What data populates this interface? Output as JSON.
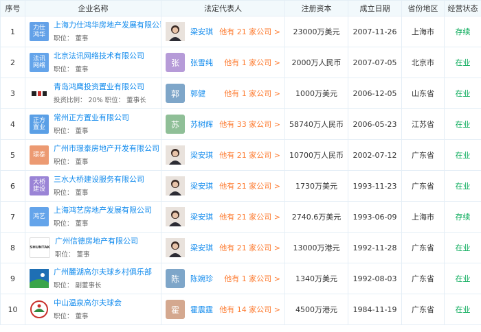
{
  "headers": {
    "index": "序号",
    "company": "企业名称",
    "rep": "法定代表人",
    "capital": "注册资本",
    "date": "成立日期",
    "region": "省份地区",
    "status": "经营状态"
  },
  "rows": [
    {
      "idx": "1",
      "logo": "力仕\n鸿华",
      "logo_color": "#63a1e8",
      "name": "上海力仕鸿华房地产发展有限公司",
      "meta": "职位：  董事",
      "rep_avatar": "",
      "rep_avatar_color": "photo",
      "rep_name": "梁安琪",
      "rep_more": "他有 21 家公司 >",
      "capital": "23000万美元",
      "date": "2007-11-26",
      "region": "上海市",
      "status": "存续"
    },
    {
      "idx": "2",
      "logo": "法讯\n网络",
      "logo_color": "#64a4ea",
      "name": "北京法讯网络技术有限公司",
      "meta": "职位：  董事",
      "rep_avatar": "张",
      "rep_avatar_color": "#b69bd8",
      "rep_name": "张雪纯",
      "rep_more": "他有 1 家公司 >",
      "capital": "2000万人民币",
      "date": "2007-07-05",
      "region": "北京市",
      "status": "在业"
    },
    {
      "idx": "3",
      "logo": "",
      "logo_color": "#ffffff",
      "name": "青岛鸿鹰投资置业有限公司",
      "meta": "投资比例：  20%      职位：  董事长",
      "rep_avatar": "郭",
      "rep_avatar_color": "#7ea6c9",
      "rep_name": "郭健",
      "rep_more": "他有 1 家公司 >",
      "capital": "1000万美元",
      "date": "2006-12-05",
      "region": "山东省",
      "status": "在业"
    },
    {
      "idx": "4",
      "logo": "正方\n置业",
      "logo_color": "#5a9fe6",
      "name": "常州正方置业有限公司",
      "meta": "职位：  董事",
      "rep_avatar": "苏",
      "rep_avatar_color": "#8fbf97",
      "rep_name": "苏树辉",
      "rep_more": "他有 33 家公司 >",
      "capital": "58740万人民币",
      "date": "2006-05-23",
      "region": "江苏省",
      "status": "在业"
    },
    {
      "idx": "5",
      "logo": "璟泰",
      "logo_color": "#ec9a72",
      "name": "广州市璟泰房地产开发有限公司",
      "meta": "职位：  董事",
      "rep_avatar": "",
      "rep_avatar_color": "photo",
      "rep_name": "梁安琪",
      "rep_more": "他有 21 家公司 >",
      "capital": "10700万人民币",
      "date": "2002-07-12",
      "region": "广东省",
      "status": "在业"
    },
    {
      "idx": "6",
      "logo": "大桥\n建设",
      "logo_color": "#9a84d6",
      "name": "三水大桥建设服务有限公司",
      "meta": "职位：  董事",
      "rep_avatar": "",
      "rep_avatar_color": "photo",
      "rep_name": "梁安琪",
      "rep_more": "他有 21 家公司 >",
      "capital": "1730万美元",
      "date": "1993-11-23",
      "region": "广东省",
      "status": "在业"
    },
    {
      "idx": "7",
      "logo": "鸿艺",
      "logo_color": "#64a4ea",
      "name": "上海鸿艺房地产发展有限公司",
      "meta": "职位：  董事",
      "rep_avatar": "",
      "rep_avatar_color": "photo",
      "rep_name": "梁安琪",
      "rep_more": "他有 21 家公司 >",
      "capital": "2740.6万美元",
      "date": "1993-06-09",
      "region": "上海市",
      "status": "存续"
    },
    {
      "idx": "8",
      "logo": "SHUNTAK",
      "logo_color": "#ffffff",
      "name": "广州信德房地产有限公司",
      "meta": "职位：  董事",
      "rep_avatar": "",
      "rep_avatar_color": "photo",
      "rep_name": "梁安琪",
      "rep_more": "他有 21 家公司 >",
      "capital": "13000万港元",
      "date": "1992-11-28",
      "region": "广东省",
      "status": "在业"
    },
    {
      "idx": "9",
      "logo": "",
      "logo_color": "#ffffff",
      "name": "广州麓湖高尔夫球乡村俱乐部",
      "meta": "职位：  副董事长",
      "rep_avatar": "陈",
      "rep_avatar_color": "#7ea6c9",
      "rep_name": "陈婉珍",
      "rep_more": "他有 1 家公司 >",
      "capital": "1340万美元",
      "date": "1992-08-03",
      "region": "广东省",
      "status": "在业"
    },
    {
      "idx": "10",
      "logo": "",
      "logo_color": "#ffffff",
      "name": "中山温泉高尔夫球会",
      "meta": "职位：  董事",
      "rep_avatar": "霍",
      "rep_avatar_color": "#d4a88f",
      "rep_name": "霍震霆",
      "rep_more": "他有 14 家公司 >",
      "capital": "4500万港元",
      "date": "1984-11-19",
      "region": "广东省",
      "status": "在业"
    }
  ],
  "colors": {
    "link": "#128bed",
    "accent": "#fd7c32",
    "status_green": "#00a854"
  }
}
